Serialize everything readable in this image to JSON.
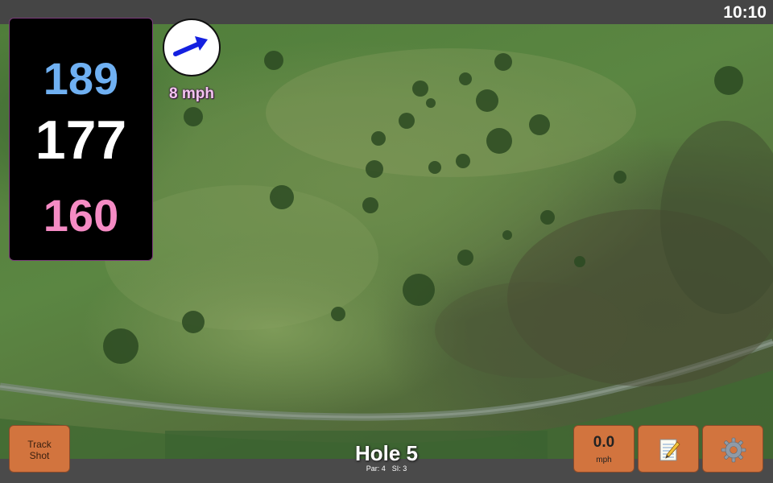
{
  "status": {
    "clock": "10:10"
  },
  "distances": {
    "back": "189",
    "middle": "177",
    "front": "160"
  },
  "wind": {
    "speed": "8 mph",
    "direction_icon": "arrow-icon"
  },
  "hole": {
    "title": "Hole 5",
    "par": "Par: 4",
    "stroke_index": "SI: 3"
  },
  "buttons": {
    "track_line1": "Track",
    "track_line2": "Shot",
    "speed_value": "0.0",
    "speed_unit": "mph",
    "notes_icon": "notepad-icon",
    "settings_icon": "gear-icon"
  },
  "colors": {
    "back": "#6fb0f2",
    "middle": "#ffffff",
    "front": "#f58bc4",
    "button": "#d2743e",
    "wind_text": "#f3c4ef"
  }
}
